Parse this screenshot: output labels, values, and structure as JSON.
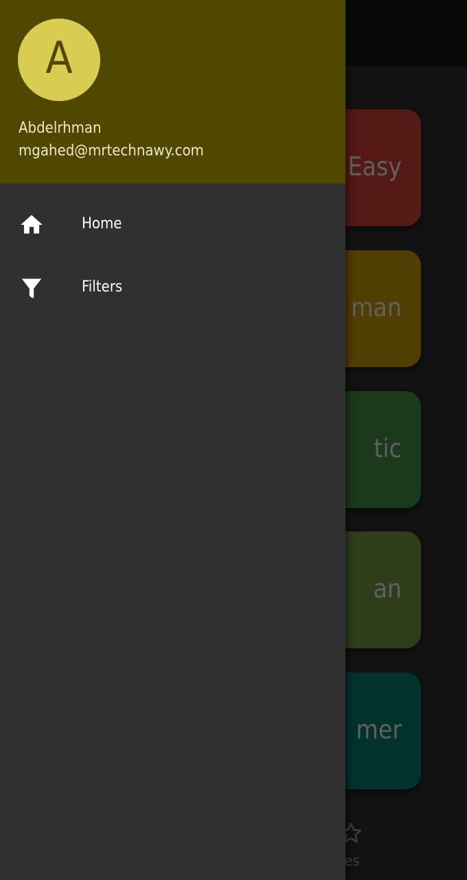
{
  "background_app": {
    "cards": [
      {
        "label": "Easy",
        "color": "#7a2520"
      },
      {
        "label": "man",
        "color": "#735a05"
      },
      {
        "label": "tic",
        "color": "#285228"
      },
      {
        "label": "an",
        "color": "#435a28"
      },
      {
        "label": "mer",
        "color": "#034840"
      }
    ],
    "bottom_nav": {
      "favorites_label": "orites",
      "favorites_icon": "star-outline-icon"
    }
  },
  "drawer": {
    "header": {
      "avatar_initial": "A",
      "account_name": "Abdelrhman",
      "account_email": "mgahed@mrtechnawy.com",
      "header_color": "#504800",
      "avatar_color": "#d8cc52"
    },
    "items": [
      {
        "label": "Home",
        "icon": "home-icon"
      },
      {
        "label": "Filters",
        "icon": "filter-icon"
      }
    ]
  }
}
